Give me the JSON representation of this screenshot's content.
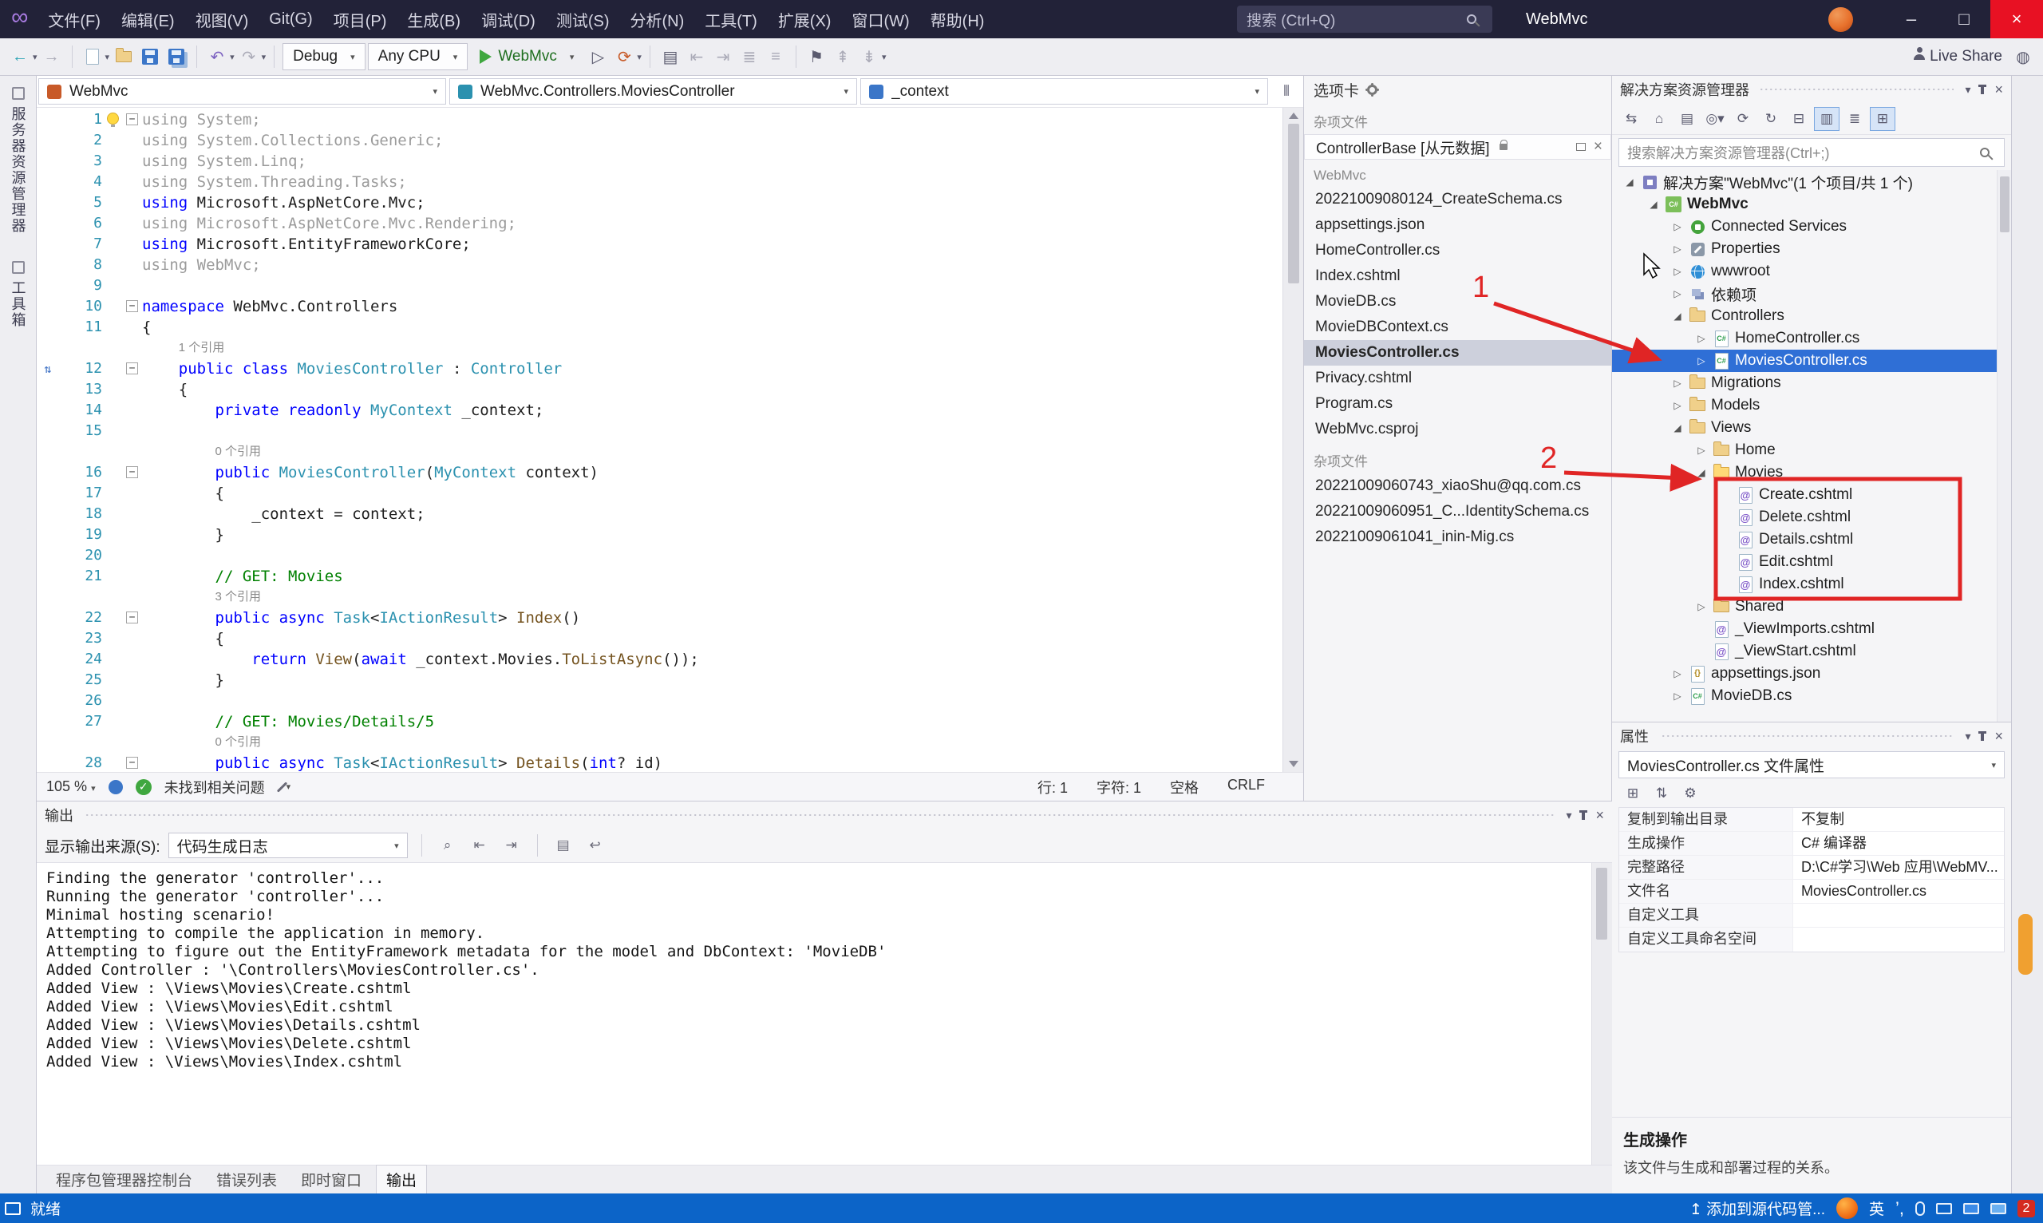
{
  "titlebar": {
    "menus": [
      "文件(F)",
      "编辑(E)",
      "视图(V)",
      "Git(G)",
      "项目(P)",
      "生成(B)",
      "调试(D)",
      "测试(S)",
      "分析(N)",
      "工具(T)",
      "扩展(X)",
      "窗口(W)",
      "帮助(H)"
    ],
    "search_placeholder": "搜索 (Ctrl+Q)",
    "window_title": "WebMvc"
  },
  "toolbar": {
    "config": "Debug",
    "platform": "Any CPU",
    "run": "WebMvc",
    "liveshare": "Live Share"
  },
  "left_strip": [
    "服务器资源管理器",
    "工具箱"
  ],
  "editor": {
    "nav": [
      "WebMvc",
      "WebMvc.Controllers.MoviesController",
      "_context"
    ],
    "lines": [
      {
        "num": 1,
        "fold": true,
        "bulb": true,
        "tokens": [
          [
            "g",
            "using System;"
          ]
        ]
      },
      {
        "num": 2,
        "tokens": [
          [
            "g",
            "using System.Collections.Generic;"
          ]
        ]
      },
      {
        "num": 3,
        "tokens": [
          [
            "g",
            "using System.Linq;"
          ]
        ]
      },
      {
        "num": 4,
        "tokens": [
          [
            "g",
            "using System.Threading.Tasks;"
          ]
        ]
      },
      {
        "num": 5,
        "tokens": [
          [
            "k",
            "using "
          ],
          [
            "p",
            "Microsoft.AspNetCore.Mvc;"
          ]
        ]
      },
      {
        "num": 6,
        "tokens": [
          [
            "g",
            "using Microsoft.AspNetCore.Mvc.Rendering;"
          ]
        ]
      },
      {
        "num": 7,
        "tokens": [
          [
            "k",
            "using "
          ],
          [
            "p",
            "Microsoft.EntityFrameworkCore;"
          ]
        ]
      },
      {
        "num": 8,
        "tokens": [
          [
            "g",
            "using WebMvc;"
          ]
        ]
      },
      {
        "num": 9,
        "tokens": []
      },
      {
        "num": 10,
        "fold": true,
        "tokens": [
          [
            "k",
            "namespace "
          ],
          [
            "p",
            "WebMvc.Controllers"
          ]
        ]
      },
      {
        "num": 11,
        "tokens": [
          [
            "p",
            "{"
          ]
        ]
      },
      {
        "lens": "1 个引用",
        "indent": 4
      },
      {
        "num": 12,
        "fold": true,
        "gutter": true,
        "tokens": [
          [
            "k",
            "    public class "
          ],
          [
            "t",
            "MoviesController"
          ],
          [
            "p",
            " : "
          ],
          [
            "t",
            "Controller"
          ]
        ]
      },
      {
        "num": 13,
        "tokens": [
          [
            "p",
            "    {"
          ]
        ]
      },
      {
        "num": 14,
        "tokens": [
          [
            "k",
            "        private readonly "
          ],
          [
            "t",
            "MyContext"
          ],
          [
            "p",
            " _context;"
          ]
        ]
      },
      {
        "num": 15,
        "tokens": []
      },
      {
        "lens": "0 个引用",
        "indent": 8
      },
      {
        "num": 16,
        "fold": true,
        "tokens": [
          [
            "k",
            "        public "
          ],
          [
            "t",
            "MoviesController"
          ],
          [
            "p",
            "("
          ],
          [
            "t",
            "MyContext"
          ],
          [
            "p",
            " context)"
          ]
        ]
      },
      {
        "num": 17,
        "tokens": [
          [
            "p",
            "        {"
          ]
        ]
      },
      {
        "num": 18,
        "tokens": [
          [
            "p",
            "            _context = context;"
          ]
        ]
      },
      {
        "num": 19,
        "tokens": [
          [
            "p",
            "        }"
          ]
        ]
      },
      {
        "num": 20,
        "tokens": []
      },
      {
        "num": 21,
        "tokens": [
          [
            "c",
            "        // GET: Movies"
          ]
        ]
      },
      {
        "lens": "3 个引用",
        "indent": 8
      },
      {
        "num": 22,
        "fold": true,
        "tokens": [
          [
            "k",
            "        public async "
          ],
          [
            "t",
            "Task"
          ],
          [
            "p",
            "<"
          ],
          [
            "t",
            "IActionResult"
          ],
          [
            "p",
            "> "
          ],
          [
            "m",
            "Index"
          ],
          [
            "p",
            "()"
          ]
        ]
      },
      {
        "num": 23,
        "tokens": [
          [
            "p",
            "        {"
          ]
        ]
      },
      {
        "num": 24,
        "tokens": [
          [
            "k",
            "            return "
          ],
          [
            "m",
            "View"
          ],
          [
            "p",
            "("
          ],
          [
            "k",
            "await"
          ],
          [
            "p",
            " _context.Movies."
          ],
          [
            "m",
            "ToListAsync"
          ],
          [
            "p",
            "());"
          ]
        ]
      },
      {
        "num": 25,
        "tokens": [
          [
            "p",
            "        }"
          ]
        ]
      },
      {
        "num": 26,
        "tokens": []
      },
      {
        "num": 27,
        "tokens": [
          [
            "c",
            "        // GET: Movies/Details/5"
          ]
        ]
      },
      {
        "lens": "0 个引用",
        "indent": 8
      },
      {
        "num": 28,
        "fold": true,
        "tokens": [
          [
            "k",
            "        public async "
          ],
          [
            "t",
            "Task"
          ],
          [
            "p",
            "<"
          ],
          [
            "t",
            "IActionResult"
          ],
          [
            "p",
            "> "
          ],
          [
            "m",
            "Details"
          ],
          [
            "p",
            "("
          ],
          [
            "k",
            "int"
          ],
          [
            "p",
            "? id)"
          ]
        ]
      }
    ],
    "status": {
      "zoom": "105 %",
      "issues": "未找到相关问题",
      "line": "行: 1",
      "col": "字符: 1",
      "spaces": "空格",
      "eol": "CRLF"
    }
  },
  "tabs_panel": {
    "title": "选项卡",
    "groups": [
      {
        "label": "杂项文件",
        "items": [
          {
            "name": "ControllerBase [从元数据]",
            "lock": true,
            "preview": true
          }
        ]
      },
      {
        "label": "WebMvc",
        "items": [
          {
            "name": "20221009080124_CreateSchema.cs"
          },
          {
            "name": "appsettings.json"
          },
          {
            "name": "HomeController.cs"
          },
          {
            "name": "Index.cshtml"
          },
          {
            "name": "MovieDB.cs"
          },
          {
            "name": "MovieDBContext.cs"
          },
          {
            "name": "MoviesController.cs",
            "active": true
          },
          {
            "name": "Privacy.cshtml"
          },
          {
            "name": "Program.cs"
          },
          {
            "name": "WebMvc.csproj"
          }
        ]
      },
      {
        "label": "杂项文件",
        "items": [
          {
            "name": "20221009060743_xiaoShu@qq.com.cs"
          },
          {
            "name": "20221009060951_C...IdentitySchema.cs"
          },
          {
            "name": "20221009061041_inin-Mig.cs"
          }
        ]
      }
    ]
  },
  "solution_explorer": {
    "title": "解决方案资源管理器",
    "search_placeholder": "搜索解决方案资源管理器(Ctrl+;)",
    "tree": [
      {
        "label": "解决方案\"WebMvc\"(1 个项目/共 1 个)",
        "level": 0,
        "arrow": "e",
        "icon": "solution"
      },
      {
        "label": "WebMvc",
        "level": 1,
        "arrow": "e",
        "icon": "project",
        "bold": true
      },
      {
        "label": "Connected Services",
        "level": 2,
        "arrow": "c",
        "icon": "services"
      },
      {
        "label": "Properties",
        "level": 2,
        "arrow": "c",
        "icon": "tools"
      },
      {
        "label": "wwwroot",
        "level": 2,
        "arrow": "c",
        "icon": "globe"
      },
      {
        "label": "依赖项",
        "level": 2,
        "arrow": "c",
        "icon": "deps"
      },
      {
        "label": "Controllers",
        "level": 2,
        "arrow": "e",
        "icon": "folder"
      },
      {
        "label": "HomeController.cs",
        "level": 3,
        "arrow": "c",
        "icon": "cs"
      },
      {
        "label": "MoviesController.cs",
        "level": 3,
        "arrow": "c",
        "icon": "cs",
        "selected": true
      },
      {
        "label": "Migrations",
        "level": 2,
        "arrow": "c",
        "icon": "folder"
      },
      {
        "label": "Models",
        "level": 2,
        "arrow": "c",
        "icon": "folder"
      },
      {
        "label": "Views",
        "level": 2,
        "arrow": "e",
        "icon": "folder"
      },
      {
        "label": "Home",
        "level": 3,
        "arrow": "c",
        "icon": "folder"
      },
      {
        "label": "Movies",
        "level": 3,
        "arrow": "e",
        "icon": "folderopen"
      },
      {
        "label": "Create.cshtml",
        "level": 4,
        "arrow": "n",
        "icon": "cshtml"
      },
      {
        "label": "Delete.cshtml",
        "level": 4,
        "arrow": "n",
        "icon": "cshtml"
      },
      {
        "label": "Details.cshtml",
        "level": 4,
        "arrow": "n",
        "icon": "cshtml"
      },
      {
        "label": "Edit.cshtml",
        "level": 4,
        "arrow": "n",
        "icon": "cshtml"
      },
      {
        "label": "Index.cshtml",
        "level": 4,
        "arrow": "n",
        "icon": "cshtml"
      },
      {
        "label": "Shared",
        "level": 3,
        "arrow": "c",
        "icon": "folder"
      },
      {
        "label": "_ViewImports.cshtml",
        "level": 3,
        "arrow": "n",
        "icon": "cshtml"
      },
      {
        "label": "_ViewStart.cshtml",
        "level": 3,
        "arrow": "n",
        "icon": "cshtml"
      },
      {
        "label": "appsettings.json",
        "level": 2,
        "arrow": "c",
        "icon": "json"
      },
      {
        "label": "MovieDB.cs",
        "level": 2,
        "arrow": "c",
        "icon": "cs"
      }
    ]
  },
  "properties": {
    "title": "属性",
    "object": "MoviesController.cs 文件属性",
    "rows": [
      [
        "复制到输出目录",
        "不复制"
      ],
      [
        "生成操作",
        "C# 编译器"
      ],
      [
        "完整路径",
        "D:\\C#学习\\Web 应用\\WebMV..."
      ],
      [
        "文件名",
        "MoviesController.cs"
      ],
      [
        "自定义工具",
        ""
      ],
      [
        "自定义工具命名空间",
        ""
      ]
    ],
    "desc_title": "生成操作",
    "desc_text": "该文件与生成和部署过程的关系。"
  },
  "output": {
    "title": "输出",
    "source_label": "显示输出来源(S):",
    "source": "代码生成日志",
    "lines": [
      "Finding the generator 'controller'...",
      "Running the generator 'controller'...",
      "Minimal hosting scenario!",
      "Attempting to compile the application in memory.",
      "Attempting to figure out the EntityFramework metadata for the model and DbContext: 'MovieDB'",
      "Added Controller : '\\Controllers\\MoviesController.cs'.",
      "Added View : \\Views\\Movies\\Create.cshtml",
      "Added View : \\Views\\Movies\\Edit.cshtml",
      "Added View : \\Views\\Movies\\Details.cshtml",
      "Added View : \\Views\\Movies\\Delete.cshtml",
      "Added View : \\Views\\Movies\\Index.cshtml"
    ],
    "tabs": [
      "程序包管理器控制台",
      "错误列表",
      "即时窗口",
      "输出"
    ],
    "active_tab": "输出"
  },
  "statusbar": {
    "ready": "就绪",
    "scm": "添加到源代码管...",
    "ime": "英",
    "badge": "2"
  },
  "annotations": {
    "n1": "1",
    "n2": "2"
  }
}
